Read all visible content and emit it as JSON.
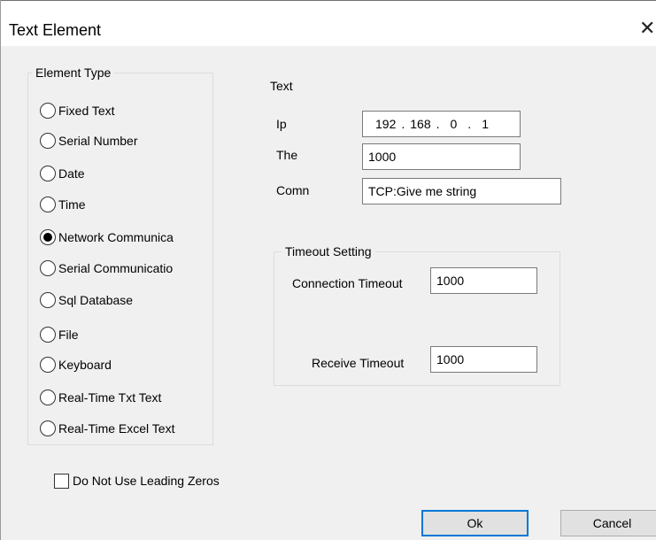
{
  "dialog": {
    "title": "Text Element",
    "close_glyph": "✕"
  },
  "element_type": {
    "label": "Element Type",
    "options": [
      {
        "label": "Fixed Text",
        "checked": false
      },
      {
        "label": "Serial Number",
        "checked": false
      },
      {
        "label": "Date",
        "checked": false
      },
      {
        "label": "Time",
        "checked": false
      },
      {
        "label": "Network Communica",
        "checked": true
      },
      {
        "label": "Serial Communicatio",
        "checked": false
      },
      {
        "label": "Sql Database",
        "checked": false
      },
      {
        "label": "File",
        "checked": false
      },
      {
        "label": "Keyboard",
        "checked": false
      },
      {
        "label": "Real-Time Txt Text",
        "checked": false
      },
      {
        "label": "Real-Time Excel Text",
        "checked": false
      }
    ]
  },
  "leading_zeros": {
    "label": "Do Not Use Leading Zeros",
    "checked": false
  },
  "text_section": {
    "heading": "Text",
    "ip_label": "Ip",
    "ip_parts": [
      "192",
      "168",
      "0",
      "1"
    ],
    "ip_separator": ".",
    "the_label": "The",
    "the_value": "1000",
    "comn_label": "Comn",
    "comn_value": "TCP:Give me string"
  },
  "timeout": {
    "label": "Timeout Setting",
    "connection_label": "Connection Timeout",
    "connection_value": "1000",
    "receive_label": "Receive Timeout",
    "receive_value": "1000"
  },
  "buttons": {
    "ok": "Ok",
    "cancel": "Cancel"
  }
}
